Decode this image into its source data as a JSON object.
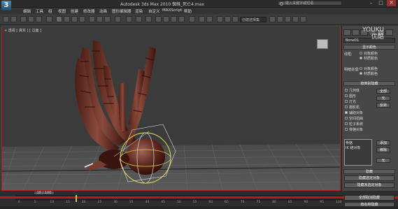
{
  "window": {
    "logo": "3",
    "title": "Autodesk 3ds Max   2010     蜘蛛_死亡4.max",
    "search_placeholder": "键入关键字或短语",
    "minimize": "–",
    "maximize": "□",
    "close": "✕"
  },
  "menu": [
    "编辑",
    "工具",
    "组",
    "视图",
    "创建",
    "修改器",
    "动画",
    "图形编辑器",
    "渲染",
    "自定义",
    "MAXScript",
    "帮助"
  ],
  "toolbar": {
    "dropdown_value": "创建选择集"
  },
  "viewport": {
    "label": "+ 透视 [ 真实 ] [ 边面 ]",
    "watermark_brand": "YOUKU",
    "watermark_sub": "优酷"
  },
  "panel": {
    "object_name": "Bone01",
    "display_color_header": "显示颜色",
    "wireframe_label": "线框:",
    "shaded_label": "明暗处理:",
    "opt_object_color": "对象颜色",
    "opt_material_color": "材质颜色",
    "hide_by_category_header": "按类别隐藏",
    "categories": [
      "几何体",
      "图形",
      "灯光",
      "摄影机",
      "辅助对象",
      "空间扭曲",
      "粒子系统",
      "骨骼对象"
    ],
    "categories_checked": [
      false,
      false,
      false,
      false,
      true,
      false,
      false,
      false
    ],
    "btn_all": "全部",
    "btn_none": "无",
    "btn_invert": "反转",
    "hidden_list_items": [
      "骨骼",
      "IK 链对象"
    ],
    "btn_add": "添加",
    "btn_remove": "移除",
    "btn_none2": "无",
    "hide_header": "隐藏",
    "btn_hide_selected": "隐藏选定对象",
    "btn_hide_unselected": "隐藏未选定对象",
    "btn_unhide_all": "全部取消隐藏",
    "btn_hide_by_name": "按名称隐藏"
  },
  "timeline": {
    "slider_text": "18 / 100",
    "ticks": [
      "0",
      "5",
      "10",
      "15",
      "20",
      "25",
      "30",
      "35",
      "40",
      "45",
      "50",
      "55",
      "60",
      "65",
      "70",
      "75",
      "80",
      "85",
      "90",
      "95",
      "100"
    ],
    "current_frame": 18,
    "total_frames": 100
  },
  "colors": {
    "viewport_border": "#b71c1c",
    "trackbar": "#c41616",
    "playhead": "#d9c23c",
    "gizmo": "#e6e34a"
  }
}
